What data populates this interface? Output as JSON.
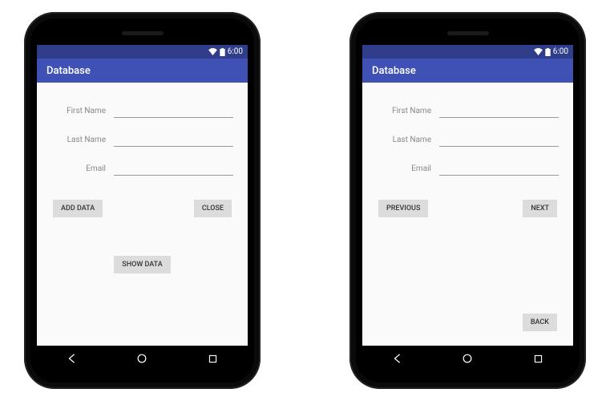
{
  "status": {
    "time": "6:00"
  },
  "left": {
    "app_title": "Database",
    "fields": {
      "first_name_label": "First Name",
      "last_name_label": "Last Name",
      "email_label": "Email",
      "first_name_value": "",
      "last_name_value": "",
      "email_value": ""
    },
    "buttons": {
      "add_data": "ADD DATA",
      "close": "CLOSE",
      "show_data": "SHOW DATA"
    }
  },
  "right": {
    "app_title": "Database",
    "fields": {
      "first_name_label": "First Name",
      "last_name_label": "Last Name",
      "email_label": "Email",
      "first_name_value": "",
      "last_name_value": "",
      "email_value": ""
    },
    "buttons": {
      "previous": "PREVIOUS",
      "next": "NEXT",
      "back": "BACK"
    }
  }
}
